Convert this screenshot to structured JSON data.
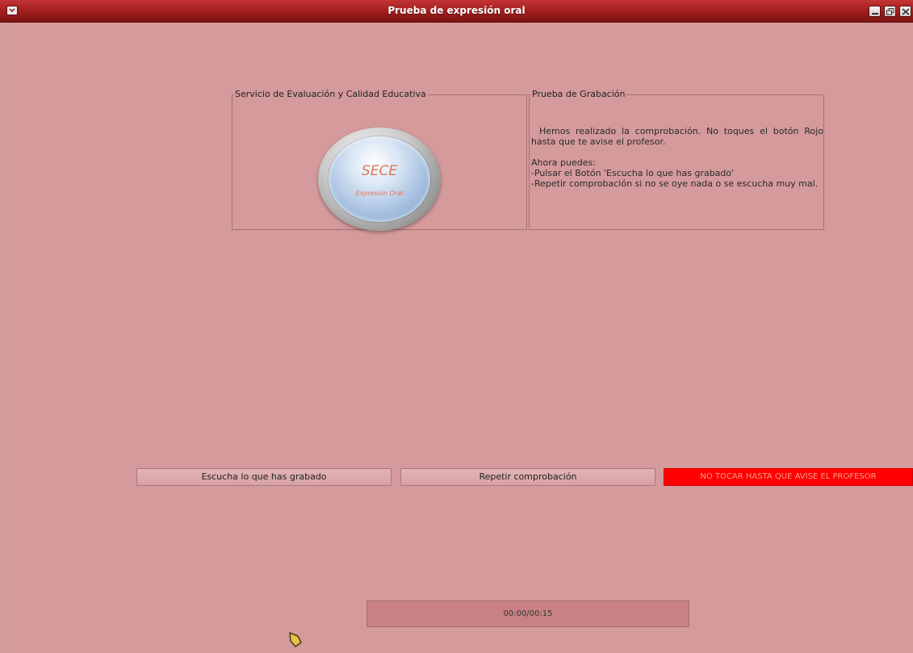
{
  "window": {
    "title": "Prueba de expresión oral",
    "menu_icon": "chevron-down-icon",
    "controls": [
      "minimize-icon",
      "restore-icon",
      "close-icon"
    ]
  },
  "logo_group": {
    "legend": "Servicio de Evaluación y Calidad Educativa",
    "logo_title": "SECE",
    "logo_subtitle": "Expresión Oral"
  },
  "info_group": {
    "legend": "Prueba de Grabación",
    "line1": "Hemos realizado la comprobación. No toques el botón Rojo hasta que te avise el profesor.",
    "line2": "Ahora puedes:",
    "line3": "-Pulsar el Botón 'Escucha lo que has grabado'",
    "line4": "-Repetir comprobación si no se oye nada o se escucha muy mal."
  },
  "buttons": {
    "listen": "Escucha lo que has grabado",
    "repeat": "Repetir comprobación",
    "do_not_touch": "NO TOCAR HASTA QUE AVISE EL PROFESOR"
  },
  "timer": {
    "text": "00:00/00:15"
  },
  "colors": {
    "background": "#d59a9b",
    "titlebar": "#9e1d1d",
    "danger_button": "#ff0000"
  }
}
